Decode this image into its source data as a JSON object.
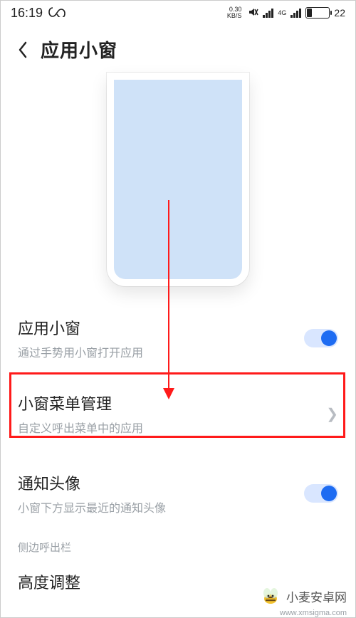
{
  "statusbar": {
    "time": "16:19",
    "net_rate_top": "0.30",
    "net_rate_bottom": "KB/S",
    "net_label": "4G",
    "battery_pct": "22"
  },
  "header": {
    "title": "应用小窗"
  },
  "rows": {
    "app_window": {
      "title": "应用小窗",
      "sub": "通过手势用小窗打开应用"
    },
    "menu_mgmt": {
      "title": "小窗菜单管理",
      "sub": "自定义呼出菜单中的应用"
    },
    "avatar": {
      "title": "通知头像",
      "sub": "小窗下方显示最近的通知头像"
    }
  },
  "category": {
    "side_bar": "侧边呼出栏"
  },
  "row3": {
    "height_adjust": "高度调整"
  },
  "watermark": {
    "brand": "小麦安卓网",
    "url": "www.xmsigma.com"
  },
  "icons": {
    "back": "chevron-left-icon",
    "infinity": "infinity-icon",
    "mute": "mute-icon",
    "chevron_right": "chevron-right-icon",
    "bee": "bee-icon"
  },
  "colors": {
    "accent": "#1e6cf2",
    "highlight": "#ff1a1a"
  }
}
